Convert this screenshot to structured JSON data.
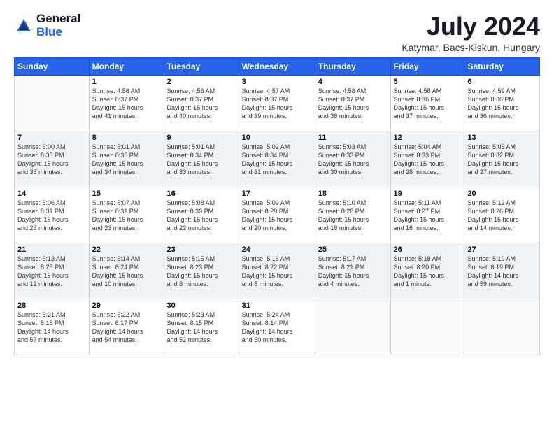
{
  "header": {
    "logo_general": "General",
    "logo_blue": "Blue",
    "month_title": "July 2024",
    "location": "Katymar, Bacs-Kiskun, Hungary"
  },
  "weekdays": [
    "Sunday",
    "Monday",
    "Tuesday",
    "Wednesday",
    "Thursday",
    "Friday",
    "Saturday"
  ],
  "weeks": [
    [
      {
        "day": "",
        "content": ""
      },
      {
        "day": "1",
        "content": "Sunrise: 4:56 AM\nSunset: 8:37 PM\nDaylight: 15 hours\nand 41 minutes."
      },
      {
        "day": "2",
        "content": "Sunrise: 4:56 AM\nSunset: 8:37 PM\nDaylight: 15 hours\nand 40 minutes."
      },
      {
        "day": "3",
        "content": "Sunrise: 4:57 AM\nSunset: 8:37 PM\nDaylight: 15 hours\nand 39 minutes."
      },
      {
        "day": "4",
        "content": "Sunrise: 4:58 AM\nSunset: 8:37 PM\nDaylight: 15 hours\nand 38 minutes."
      },
      {
        "day": "5",
        "content": "Sunrise: 4:58 AM\nSunset: 8:36 PM\nDaylight: 15 hours\nand 37 minutes."
      },
      {
        "day": "6",
        "content": "Sunrise: 4:59 AM\nSunset: 8:36 PM\nDaylight: 15 hours\nand 36 minutes."
      }
    ],
    [
      {
        "day": "7",
        "content": "Sunrise: 5:00 AM\nSunset: 8:35 PM\nDaylight: 15 hours\nand 35 minutes."
      },
      {
        "day": "8",
        "content": "Sunrise: 5:01 AM\nSunset: 8:35 PM\nDaylight: 15 hours\nand 34 minutes."
      },
      {
        "day": "9",
        "content": "Sunrise: 5:01 AM\nSunset: 8:34 PM\nDaylight: 15 hours\nand 33 minutes."
      },
      {
        "day": "10",
        "content": "Sunrise: 5:02 AM\nSunset: 8:34 PM\nDaylight: 15 hours\nand 31 minutes."
      },
      {
        "day": "11",
        "content": "Sunrise: 5:03 AM\nSunset: 8:33 PM\nDaylight: 15 hours\nand 30 minutes."
      },
      {
        "day": "12",
        "content": "Sunrise: 5:04 AM\nSunset: 8:33 PM\nDaylight: 15 hours\nand 28 minutes."
      },
      {
        "day": "13",
        "content": "Sunrise: 5:05 AM\nSunset: 8:32 PM\nDaylight: 15 hours\nand 27 minutes."
      }
    ],
    [
      {
        "day": "14",
        "content": "Sunrise: 5:06 AM\nSunset: 8:31 PM\nDaylight: 15 hours\nand 25 minutes."
      },
      {
        "day": "15",
        "content": "Sunrise: 5:07 AM\nSunset: 8:31 PM\nDaylight: 15 hours\nand 23 minutes."
      },
      {
        "day": "16",
        "content": "Sunrise: 5:08 AM\nSunset: 8:30 PM\nDaylight: 15 hours\nand 22 minutes."
      },
      {
        "day": "17",
        "content": "Sunrise: 5:09 AM\nSunset: 8:29 PM\nDaylight: 15 hours\nand 20 minutes."
      },
      {
        "day": "18",
        "content": "Sunrise: 5:10 AM\nSunset: 8:28 PM\nDaylight: 15 hours\nand 18 minutes."
      },
      {
        "day": "19",
        "content": "Sunrise: 5:11 AM\nSunset: 8:27 PM\nDaylight: 15 hours\nand 16 minutes."
      },
      {
        "day": "20",
        "content": "Sunrise: 5:12 AM\nSunset: 8:26 PM\nDaylight: 15 hours\nand 14 minutes."
      }
    ],
    [
      {
        "day": "21",
        "content": "Sunrise: 5:13 AM\nSunset: 8:25 PM\nDaylight: 15 hours\nand 12 minutes."
      },
      {
        "day": "22",
        "content": "Sunrise: 5:14 AM\nSunset: 8:24 PM\nDaylight: 15 hours\nand 10 minutes."
      },
      {
        "day": "23",
        "content": "Sunrise: 5:15 AM\nSunset: 8:23 PM\nDaylight: 15 hours\nand 8 minutes."
      },
      {
        "day": "24",
        "content": "Sunrise: 5:16 AM\nSunset: 8:22 PM\nDaylight: 15 hours\nand 6 minutes."
      },
      {
        "day": "25",
        "content": "Sunrise: 5:17 AM\nSunset: 8:21 PM\nDaylight: 15 hours\nand 4 minutes."
      },
      {
        "day": "26",
        "content": "Sunrise: 5:18 AM\nSunset: 8:20 PM\nDaylight: 15 hours\nand 1 minute."
      },
      {
        "day": "27",
        "content": "Sunrise: 5:19 AM\nSunset: 8:19 PM\nDaylight: 14 hours\nand 59 minutes."
      }
    ],
    [
      {
        "day": "28",
        "content": "Sunrise: 5:21 AM\nSunset: 8:18 PM\nDaylight: 14 hours\nand 57 minutes."
      },
      {
        "day": "29",
        "content": "Sunrise: 5:22 AM\nSunset: 8:17 PM\nDaylight: 14 hours\nand 54 minutes."
      },
      {
        "day": "30",
        "content": "Sunrise: 5:23 AM\nSunset: 8:15 PM\nDaylight: 14 hours\nand 52 minutes."
      },
      {
        "day": "31",
        "content": "Sunrise: 5:24 AM\nSunset: 8:14 PM\nDaylight: 14 hours\nand 50 minutes."
      },
      {
        "day": "",
        "content": ""
      },
      {
        "day": "",
        "content": ""
      },
      {
        "day": "",
        "content": ""
      }
    ]
  ]
}
